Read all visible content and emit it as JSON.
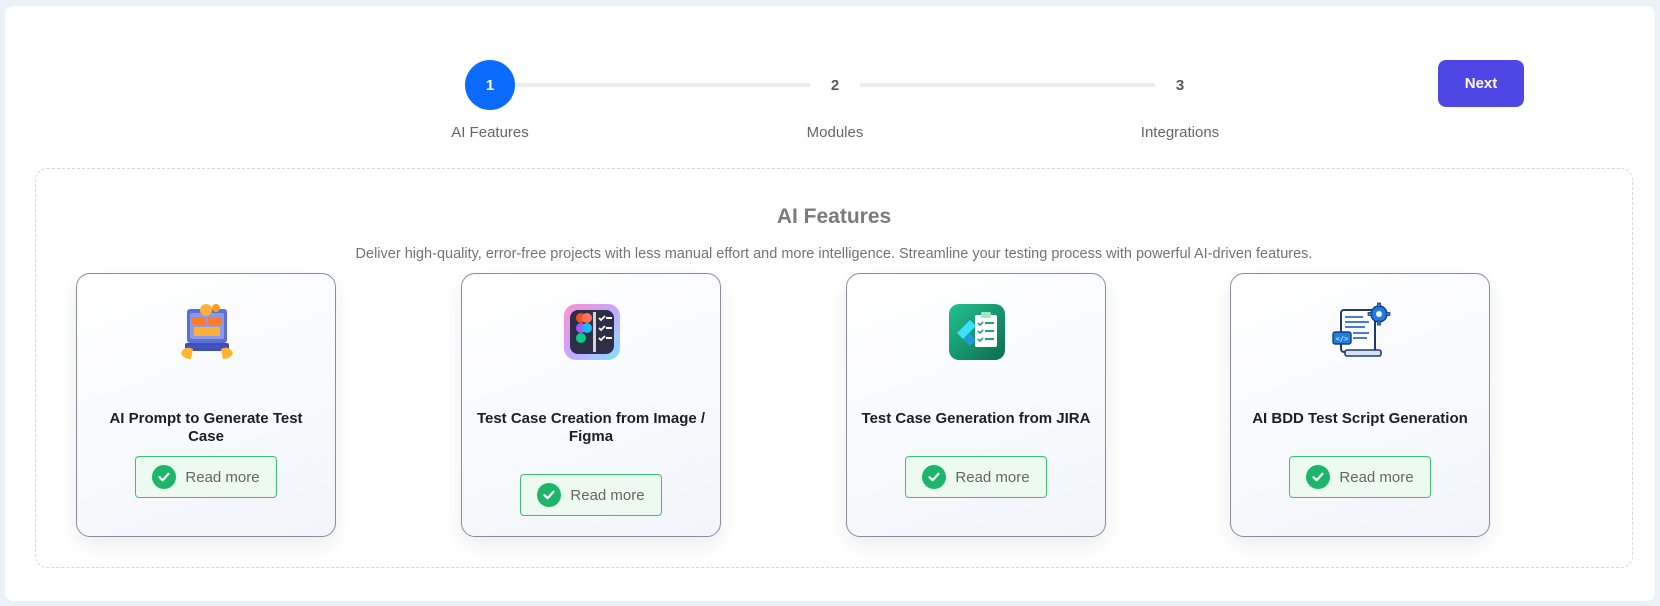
{
  "stepper": {
    "steps": [
      {
        "number": "1",
        "label": "AI Features"
      },
      {
        "number": "2",
        "label": "Modules"
      },
      {
        "number": "3",
        "label": "Integrations"
      }
    ],
    "active_step": 1,
    "next_label": "Next"
  },
  "section": {
    "title": "AI Features",
    "description": "Deliver high-quality, error-free projects with less manual effort and more intelligence. Streamline your testing process with powerful AI-driven features."
  },
  "cards": [
    {
      "title": "AI Prompt to Generate Test Case",
      "button": "Read more",
      "icon": "ai-prompt-icon"
    },
    {
      "title": "Test Case Creation from Image / Figma",
      "button": "Read more",
      "icon": "figma-checklist-icon"
    },
    {
      "title": "Test Case Generation from JIRA",
      "button": "Read more",
      "icon": "jira-clipboard-icon"
    },
    {
      "title": "AI BDD Test Script Generation",
      "button": "Read more",
      "icon": "bdd-script-icon"
    }
  ],
  "colors": {
    "primary": "#0b6bff",
    "next_button": "#4e47e5",
    "success": "#1db56a"
  }
}
